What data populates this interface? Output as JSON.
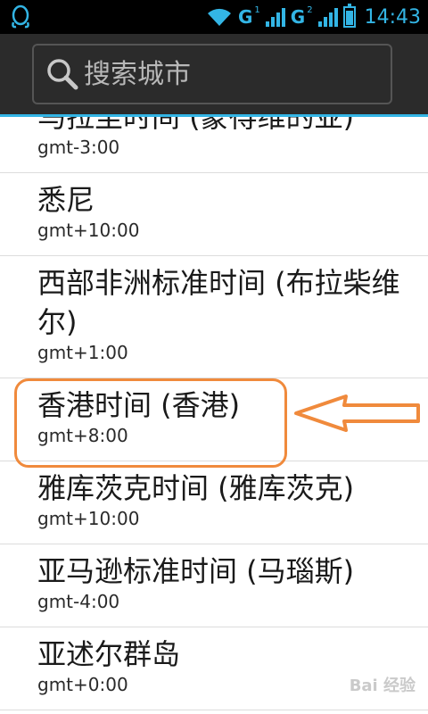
{
  "status_bar": {
    "left_icon": "qq-penguin-icon",
    "wifi_icon": "wifi-icon",
    "sim1_network": "G",
    "sim1_slot": "1",
    "sim2_network": "G",
    "sim2_slot": "2",
    "battery_level": 0.8,
    "time": "14:43",
    "accent_color": "#33b5e5"
  },
  "search": {
    "placeholder": "搜索城市",
    "value": ""
  },
  "timezones": [
    {
      "name": "马拉圭时间 (蒙得维的亚)",
      "gmt": "gmt-3:00"
    },
    {
      "name": "悉尼",
      "gmt": "gmt+10:00"
    },
    {
      "name": "西部非洲标准时间 (布拉柴维尔)",
      "gmt": "gmt+1:00"
    },
    {
      "name": "香港时间 (香港)",
      "gmt": "gmt+8:00"
    },
    {
      "name": "雅库茨克时间 (雅库茨克)",
      "gmt": "gmt+10:00"
    },
    {
      "name": "亚马逊标准时间 (马瑙斯)",
      "gmt": "gmt-4:00"
    },
    {
      "name": "亚述尔群岛",
      "gmt": "gmt+0:00"
    }
  ],
  "annotation": {
    "highlight_color": "#f08a3c"
  },
  "watermark": {
    "text": "Bai 经验"
  }
}
